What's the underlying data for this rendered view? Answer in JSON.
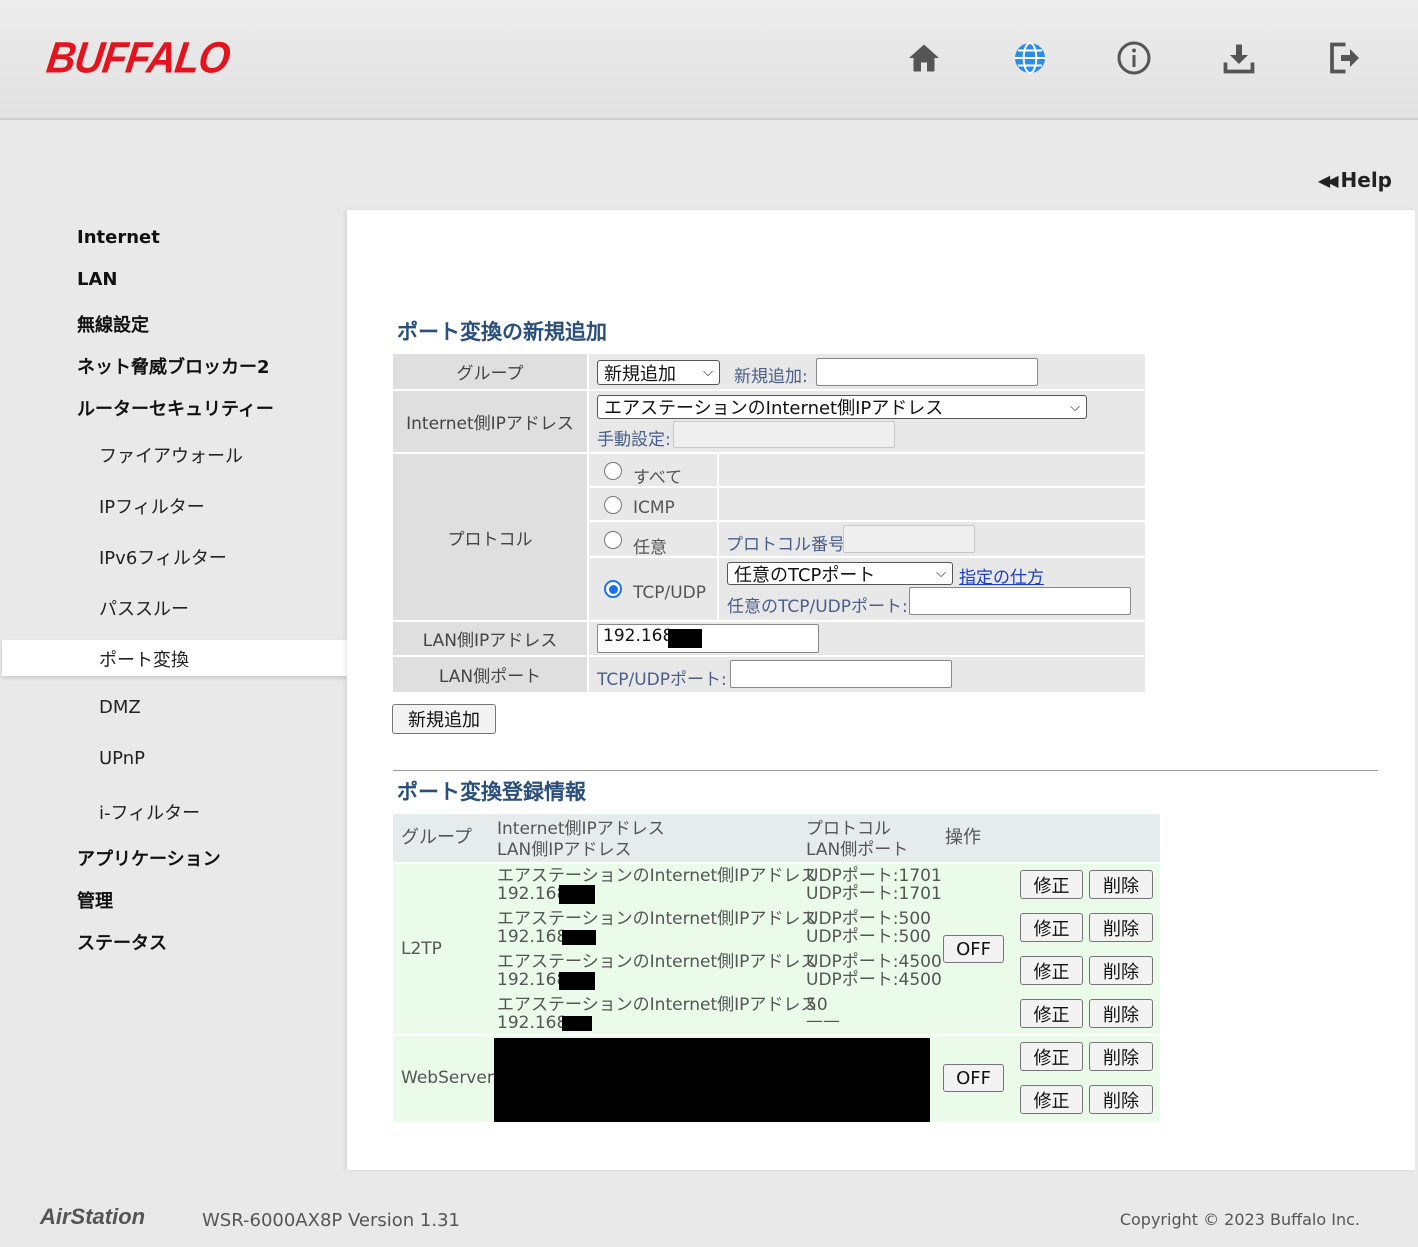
{
  "header": {
    "logo": "BUFFALO",
    "icons": [
      "home-icon",
      "globe-icon",
      "info-icon",
      "download-icon",
      "logout-icon"
    ]
  },
  "help": {
    "label": "Help",
    "arrows": "◀◀"
  },
  "sidebar": {
    "items": [
      {
        "label": "Internet"
      },
      {
        "label": "LAN"
      },
      {
        "label": "無線設定"
      },
      {
        "label": "ネット脅威ブロッカー2"
      },
      {
        "label": "ルーターセキュリティー"
      },
      {
        "label": "アプリケーション"
      },
      {
        "label": "管理"
      },
      {
        "label": "ステータス"
      }
    ],
    "sub_items": [
      {
        "label": "ファイアウォール"
      },
      {
        "label": "IPフィルター"
      },
      {
        "label": "IPv6フィルター"
      },
      {
        "label": "パススルー"
      },
      {
        "label": "ポート変換"
      },
      {
        "label": "DMZ"
      },
      {
        "label": "UPnP"
      },
      {
        "label": "i-フィルター"
      }
    ],
    "active": "ポート変換"
  },
  "add_section": {
    "title": "ポート変換の新規追加",
    "group": {
      "label": "グループ",
      "select_value": "新規追加",
      "new_label": "新規追加:",
      "new_value": ""
    },
    "internet_ip": {
      "label": "Internet側IPアドレス",
      "select_value": "エアステーションのInternet側IPアドレス",
      "manual_label": "手動設定:",
      "manual_value": ""
    },
    "protocol": {
      "label": "プロトコル",
      "options": {
        "all": "すべて",
        "icmp": "ICMP",
        "any": "任意",
        "tcpudp": "TCP/UDP"
      },
      "proto_number_label": "プロトコル番号:",
      "proto_number_value": "",
      "port_select_value": "任意のTCPポート",
      "howto_link": "指定の仕方",
      "any_port_label": "任意のTCP/UDPポート:",
      "any_port_value": "",
      "selected": "TCP/UDP"
    },
    "lan_ip": {
      "label": "LAN側IPアドレス",
      "value": "192.168."
    },
    "lan_port": {
      "label": "LAN側ポート",
      "port_label": "TCP/UDPポート:",
      "value": ""
    },
    "add_button": "新規追加"
  },
  "registered": {
    "title": "ポート変換登録情報",
    "headers": {
      "group": "グループ",
      "ip_line1": "Internet側IPアドレス",
      "ip_line2": "LAN側IPアドレス",
      "proto_line1": "プロトコル",
      "proto_line2": "LAN側ポート",
      "action": "操作"
    },
    "groups": [
      {
        "name": "L2TP",
        "toggle": "OFF",
        "rows": [
          {
            "wan": "エアステーションのInternet側IPアドレス",
            "lan": "192.168.",
            "proto": "UDPポート:1701",
            "port": "UDPポート:1701"
          },
          {
            "wan": "エアステーションのInternet側IPアドレス",
            "lan": "192.168.",
            "proto": "UDPポート:500",
            "port": "UDPポート:500"
          },
          {
            "wan": "エアステーションのInternet側IPアドレス",
            "lan": "192.168.",
            "proto": "UDPポート:4500",
            "port": "UDPポート:4500"
          },
          {
            "wan": "エアステーションのInternet側IPアドレス",
            "lan": "192.168.",
            "proto": "50",
            "port": "——"
          }
        ]
      },
      {
        "name": "WebServer",
        "toggle": "OFF",
        "rows": [
          {},
          {}
        ]
      }
    ],
    "edit_label": "修正",
    "delete_label": "削除"
  },
  "footer": {
    "brand": "AirStation",
    "model": "WSR-6000AX8P   Version 1.31",
    "copyright": "Copyright © 2023 Buffalo Inc."
  }
}
